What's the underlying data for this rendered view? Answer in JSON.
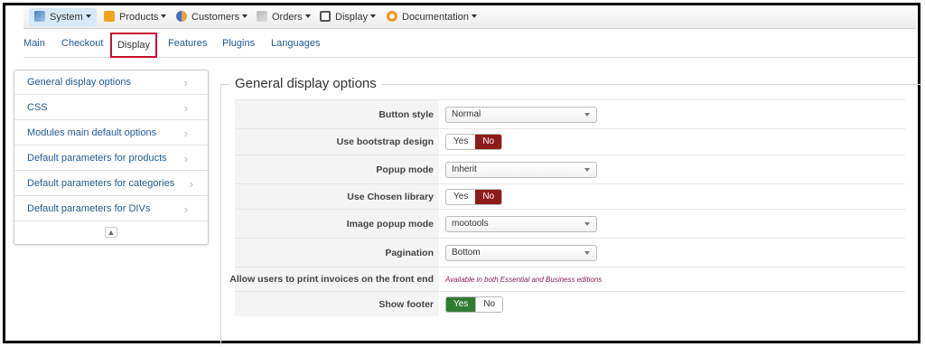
{
  "topmenu": {
    "items": [
      {
        "label": "System",
        "icon": "wrench-icon",
        "active": true
      },
      {
        "label": "Products",
        "icon": "box-icon"
      },
      {
        "label": "Customers",
        "icon": "users-icon"
      },
      {
        "label": "Orders",
        "icon": "pen-icon"
      },
      {
        "label": "Display",
        "icon": "screen-icon"
      },
      {
        "label": "Documentation",
        "icon": "lifebuoy-icon"
      }
    ]
  },
  "subtabs": [
    "Main",
    "Checkout",
    "Display",
    "Features",
    "Plugins",
    "Languages"
  ],
  "sidebar": {
    "items": [
      "General display options",
      "CSS",
      "Modules main default options",
      "Default parameters for products",
      "Default parameters for categories",
      "Default parameters for DIVs"
    ],
    "collapse_glyph": "▲"
  },
  "section": {
    "title": "General display options"
  },
  "settings": {
    "button_style": {
      "label": "Button style",
      "value": "Normal"
    },
    "use_bootstrap": {
      "label": "Use bootstrap design",
      "yes": "Yes",
      "no": "No",
      "selected": "No"
    },
    "popup_mode": {
      "label": "Popup mode",
      "value": "Inherit"
    },
    "use_chosen": {
      "label": "Use Chosen library",
      "yes": "Yes",
      "no": "No",
      "selected": "No"
    },
    "image_popup_mode": {
      "label": "Image popup mode",
      "value": "mootools"
    },
    "pagination": {
      "label": "Pagination",
      "value": "Bottom"
    },
    "print_invoices": {
      "label": "Allow users to print invoices on the front end",
      "note": "Available in both Essential and Business editions"
    },
    "show_footer": {
      "label": "Show footer",
      "yes": "Yes",
      "no": "No",
      "selected": "Yes"
    }
  },
  "colors": {
    "accent_link": "#1f5a92",
    "no_active": "#8e1b1b",
    "yes_active": "#2e7d32",
    "highlight_box": "#c8102e"
  }
}
